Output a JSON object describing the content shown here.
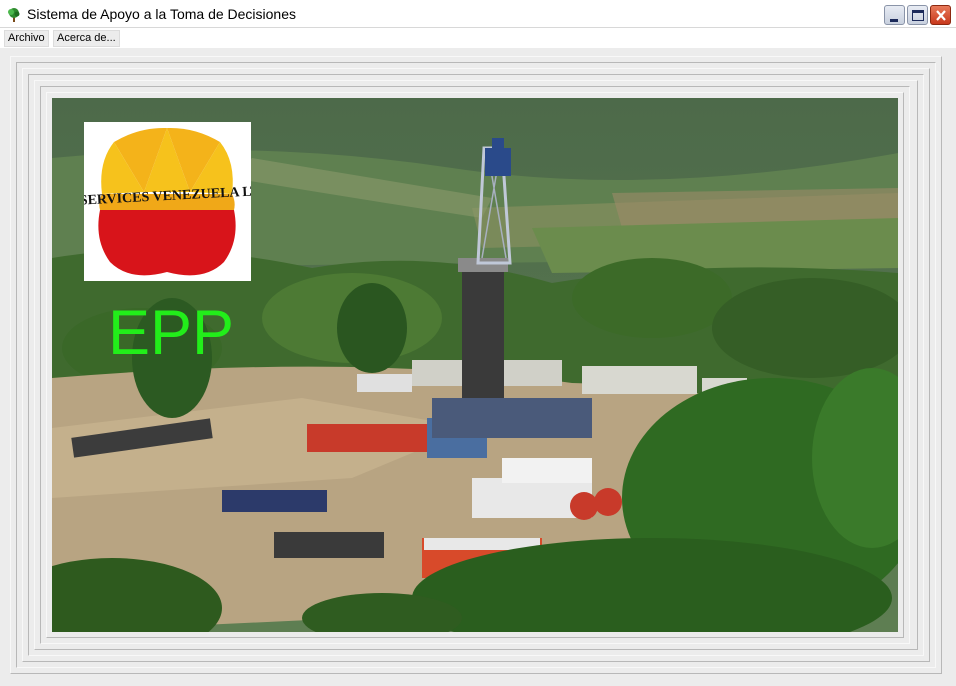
{
  "window": {
    "title": "Sistema de Apoyo a la Toma de Decisiones",
    "app_icon": "tree-icon",
    "controls": [
      "minimize-icon",
      "maximize-icon",
      "close-icon"
    ]
  },
  "menu": {
    "archivo": "Archivo",
    "acerca": "Acerca de..."
  },
  "content": {
    "logo_text": "CNPC SERVICES VENEZUELA LTD, S.A",
    "epp_label": "EPP",
    "photo_subject": "drilling-rig-photo"
  },
  "colors": {
    "epp_green": "#22ee1a",
    "logo_yellow": "#f6c21c",
    "logo_red": "#d8141a",
    "close_red": "#c8381c"
  }
}
